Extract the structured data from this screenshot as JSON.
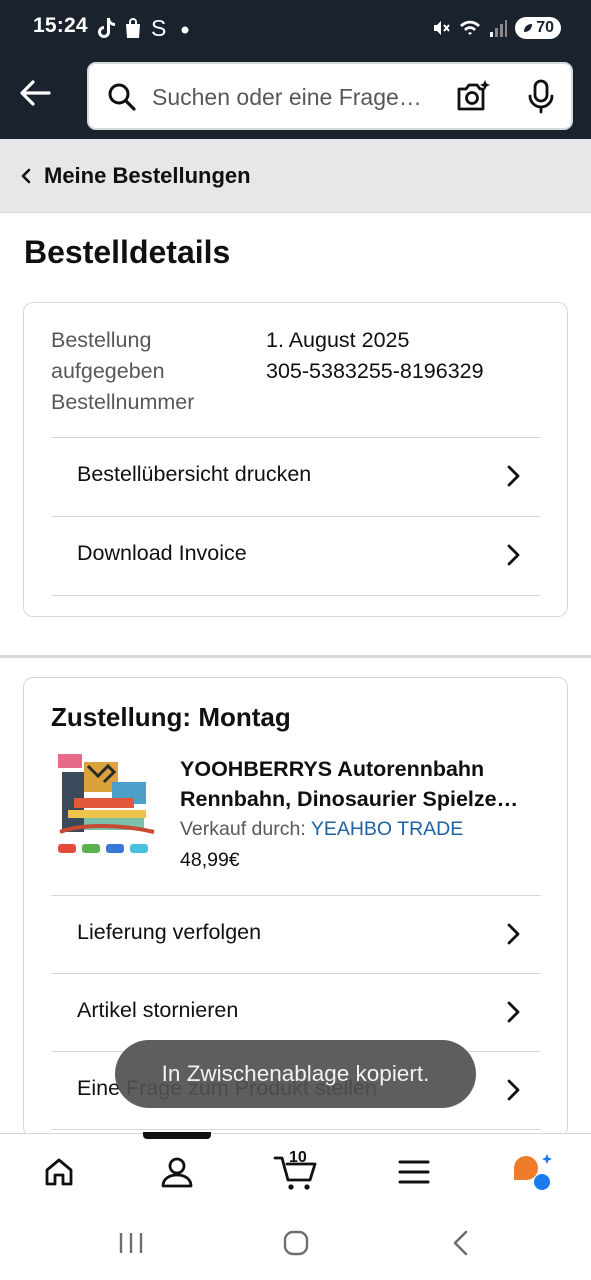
{
  "status_bar": {
    "time": "15:24",
    "left_icons": [
      "tiktok-icon",
      "shopping-bag-icon",
      "s-icon",
      "dot-icon"
    ],
    "right_icons": [
      "mute-icon",
      "wifi-icon",
      "signal-icon"
    ],
    "battery": "70"
  },
  "header": {
    "search_placeholder": "Suchen oder eine Frage…",
    "icons": [
      "back-arrow-icon",
      "search-icon",
      "camera-icon",
      "mic-icon"
    ]
  },
  "breadcrumb": {
    "label": "Meine Bestellungen"
  },
  "page": {
    "title": "Bestelldetails"
  },
  "order_info": {
    "placed_label": "Bestellung aufgegeben",
    "number_label": "Bestellnummer",
    "placed_value": "1. August 2025",
    "number_value": "305-5383255-8196329",
    "actions": [
      {
        "label": "Bestellübersicht drucken"
      },
      {
        "label": "Download Invoice"
      }
    ]
  },
  "shipment": {
    "title": "Zustellung: Montag",
    "product": {
      "title_line1": "YOOHBERRYS Autorennbahn",
      "title_line2": "Rennbahn, Dinosaurier Spielze…",
      "seller_prefix": "Verkauf durch: ",
      "seller_name": "YEAHBO TRADE",
      "price": "48,99€"
    },
    "actions": [
      {
        "label": "Lieferung verfolgen"
      },
      {
        "label": "Artikel stornieren"
      },
      {
        "label": "Eine Frage zum Produkt stellen"
      }
    ]
  },
  "toast": {
    "text": "In Zwischenablage kopiert."
  },
  "bottom_nav": {
    "cart_count": "10",
    "items": [
      "home-icon",
      "account-icon",
      "cart-icon",
      "menu-icon",
      "rufus-icon"
    ],
    "selected": "account-icon"
  },
  "colors": {
    "header_bg": "#1a232d",
    "breadcrumb_bg": "#e6e7e8",
    "link": "#2162a1",
    "rufus_orange": "#f07c2b",
    "rufus_blue": "#1b7cf2"
  }
}
